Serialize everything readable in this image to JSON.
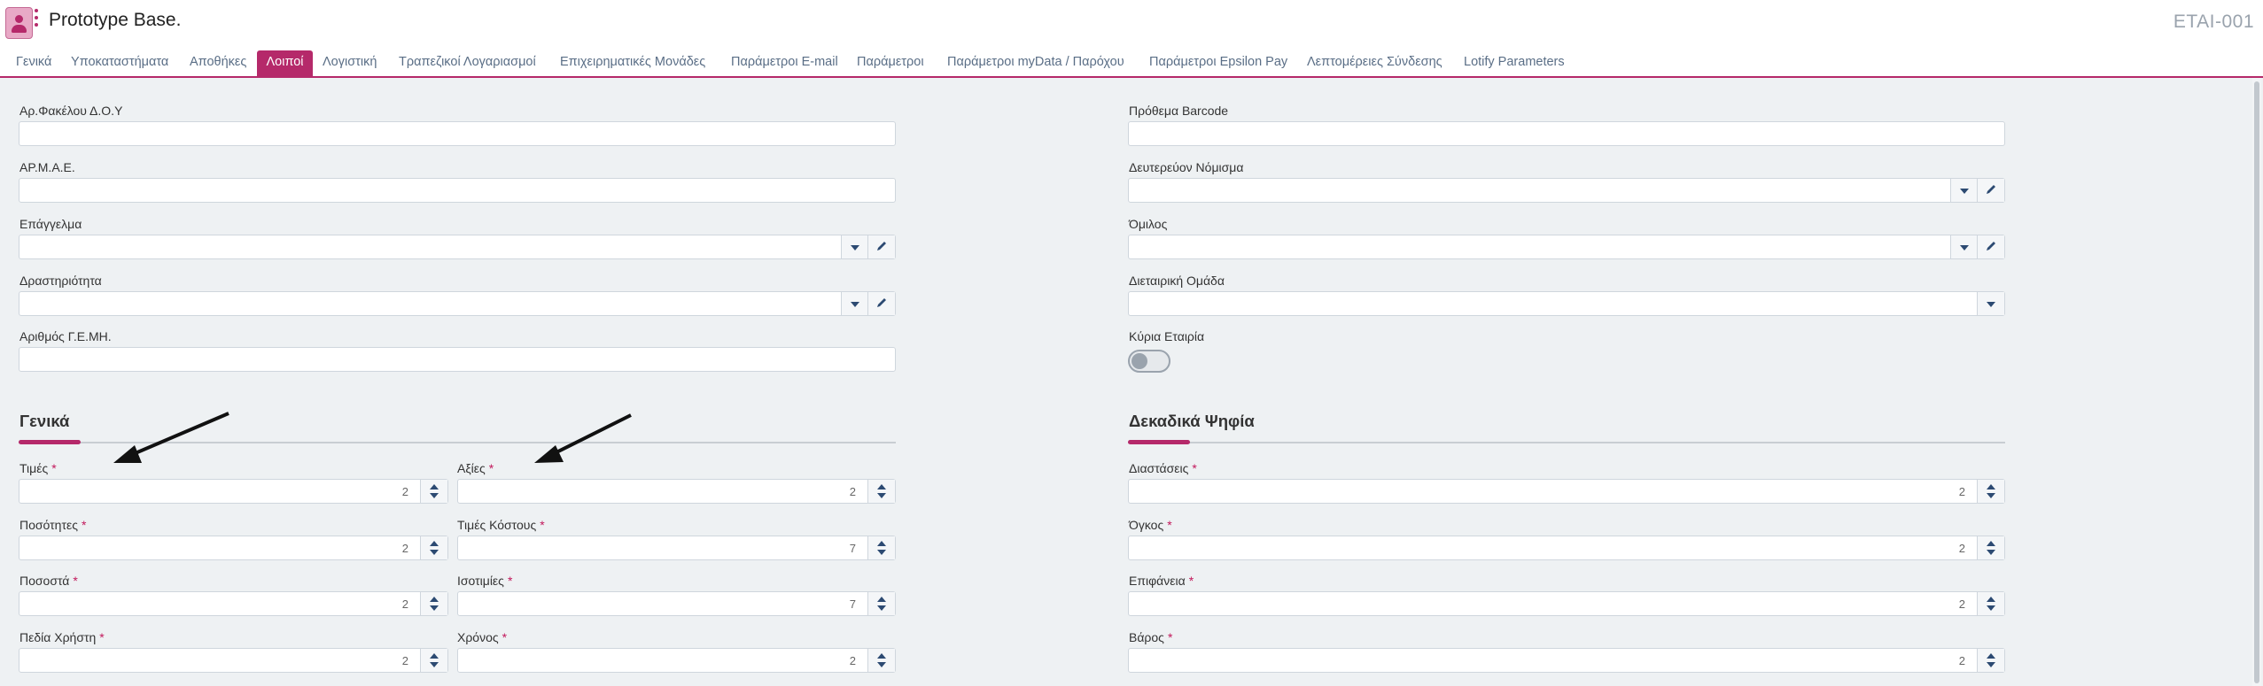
{
  "header": {
    "title": "Prototype Base.",
    "company": "ETAI-001",
    "icons": {
      "app": "person-icon",
      "menu": "kebab-menu-icon"
    }
  },
  "tabs": [
    {
      "label": "Γενικά",
      "active": false
    },
    {
      "label": "Υποκαταστήματα",
      "active": false
    },
    {
      "label": "Αποθήκες",
      "active": false
    },
    {
      "label": "Λοιποί",
      "active": true
    },
    {
      "label": "Λογιστική",
      "active": false
    },
    {
      "label": "Τραπεζικοί Λογαριασμοί",
      "active": false
    },
    {
      "label": "Επιχειρηματικές Μονάδες",
      "active": false
    },
    {
      "label": "Παράμετροι E-mail",
      "active": false
    },
    {
      "label": "Παράμετροι",
      "active": false
    },
    {
      "label": "Παράμετροι myData / Παρόχου",
      "active": false
    },
    {
      "label": "Παράμετροι Epsilon Pay",
      "active": false
    },
    {
      "label": "Λεπτομέρειες Σύνδεσης",
      "active": false
    },
    {
      "label": "Lotify Parameters",
      "active": false
    }
  ],
  "left_fields": {
    "ar_fakelou": {
      "label": "Αρ.Φακέλου Δ.Ο.Υ",
      "value": ""
    },
    "armae": {
      "label": "ΑΡ.Μ.Α.Ε.",
      "value": ""
    },
    "epaggelma": {
      "label": "Επάγγελμα",
      "value": ""
    },
    "drastiriotita": {
      "label": "Δραστηριότητα",
      "value": ""
    },
    "gemi": {
      "label": "Αριθμός Γ.Ε.ΜΗ.",
      "value": ""
    }
  },
  "right_fields": {
    "barcode": {
      "label": "Πρόθεμα Barcode",
      "value": ""
    },
    "currency": {
      "label": "Δευτερεύον Νόμισμα",
      "value": ""
    },
    "omilos": {
      "label": "Όμιλος",
      "value": ""
    },
    "group": {
      "label": "Διεταιρική Ομάδα",
      "value": ""
    },
    "main_company": {
      "label": "Κύρια Εταιρία",
      "value": false
    }
  },
  "sections": {
    "general": "Γενικά",
    "decimals": "Δεκαδικά Ψηφία"
  },
  "required_mark": "*",
  "general_fields": {
    "times": {
      "label": "Τιμές",
      "value": "2"
    },
    "axies": {
      "label": "Αξίες",
      "value": "2"
    },
    "posotites": {
      "label": "Ποσότητες",
      "value": "2"
    },
    "times_kostous": {
      "label": "Τιμές Κόστους",
      "value": "7"
    },
    "pososta": {
      "label": "Ποσοστά",
      "value": "2"
    },
    "isotimies": {
      "label": "Ισοτιμίες",
      "value": "7"
    },
    "pedia_xristi": {
      "label": "Πεδία Χρήστη",
      "value": "2"
    },
    "xronos": {
      "label": "Χρόνος",
      "value": "2"
    }
  },
  "decimal_fields": {
    "diastaseis": {
      "label": "Διαστάσεις",
      "value": "2"
    },
    "ogkos": {
      "label": "Όγκος",
      "value": "2"
    },
    "epifaneia": {
      "label": "Επιφάνεια",
      "value": "2"
    },
    "varos": {
      "label": "Βάρος",
      "value": "2"
    }
  },
  "colors": {
    "accent": "#b5296a",
    "link": "#5a6e86",
    "background": "#eef1f3"
  }
}
